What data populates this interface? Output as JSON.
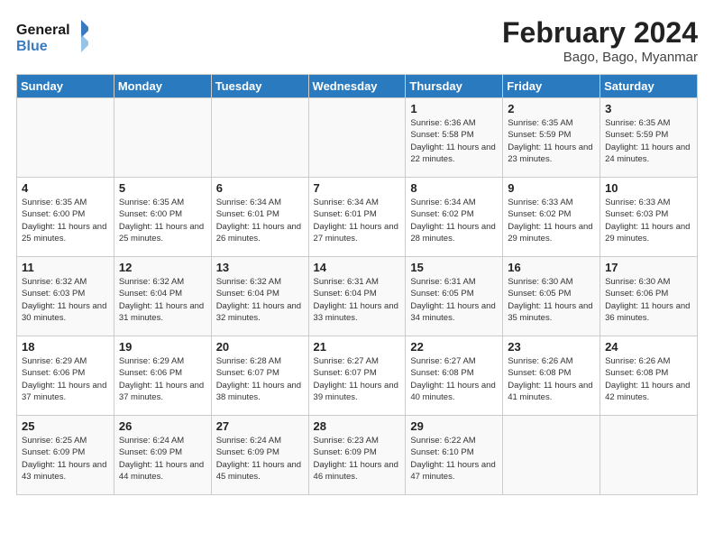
{
  "header": {
    "logo_line1": "General",
    "logo_line2": "Blue",
    "title": "February 2024",
    "subtitle": "Bago, Bago, Myanmar"
  },
  "days_of_week": [
    "Sunday",
    "Monday",
    "Tuesday",
    "Wednesday",
    "Thursday",
    "Friday",
    "Saturday"
  ],
  "weeks": [
    [
      {
        "day": "",
        "info": ""
      },
      {
        "day": "",
        "info": ""
      },
      {
        "day": "",
        "info": ""
      },
      {
        "day": "",
        "info": ""
      },
      {
        "day": "1",
        "info": "Sunrise: 6:36 AM\nSunset: 5:58 PM\nDaylight: 11 hours and 22 minutes."
      },
      {
        "day": "2",
        "info": "Sunrise: 6:35 AM\nSunset: 5:59 PM\nDaylight: 11 hours and 23 minutes."
      },
      {
        "day": "3",
        "info": "Sunrise: 6:35 AM\nSunset: 5:59 PM\nDaylight: 11 hours and 24 minutes."
      }
    ],
    [
      {
        "day": "4",
        "info": "Sunrise: 6:35 AM\nSunset: 6:00 PM\nDaylight: 11 hours and 25 minutes."
      },
      {
        "day": "5",
        "info": "Sunrise: 6:35 AM\nSunset: 6:00 PM\nDaylight: 11 hours and 25 minutes."
      },
      {
        "day": "6",
        "info": "Sunrise: 6:34 AM\nSunset: 6:01 PM\nDaylight: 11 hours and 26 minutes."
      },
      {
        "day": "7",
        "info": "Sunrise: 6:34 AM\nSunset: 6:01 PM\nDaylight: 11 hours and 27 minutes."
      },
      {
        "day": "8",
        "info": "Sunrise: 6:34 AM\nSunset: 6:02 PM\nDaylight: 11 hours and 28 minutes."
      },
      {
        "day": "9",
        "info": "Sunrise: 6:33 AM\nSunset: 6:02 PM\nDaylight: 11 hours and 29 minutes."
      },
      {
        "day": "10",
        "info": "Sunrise: 6:33 AM\nSunset: 6:03 PM\nDaylight: 11 hours and 29 minutes."
      }
    ],
    [
      {
        "day": "11",
        "info": "Sunrise: 6:32 AM\nSunset: 6:03 PM\nDaylight: 11 hours and 30 minutes."
      },
      {
        "day": "12",
        "info": "Sunrise: 6:32 AM\nSunset: 6:04 PM\nDaylight: 11 hours and 31 minutes."
      },
      {
        "day": "13",
        "info": "Sunrise: 6:32 AM\nSunset: 6:04 PM\nDaylight: 11 hours and 32 minutes."
      },
      {
        "day": "14",
        "info": "Sunrise: 6:31 AM\nSunset: 6:04 PM\nDaylight: 11 hours and 33 minutes."
      },
      {
        "day": "15",
        "info": "Sunrise: 6:31 AM\nSunset: 6:05 PM\nDaylight: 11 hours and 34 minutes."
      },
      {
        "day": "16",
        "info": "Sunrise: 6:30 AM\nSunset: 6:05 PM\nDaylight: 11 hours and 35 minutes."
      },
      {
        "day": "17",
        "info": "Sunrise: 6:30 AM\nSunset: 6:06 PM\nDaylight: 11 hours and 36 minutes."
      }
    ],
    [
      {
        "day": "18",
        "info": "Sunrise: 6:29 AM\nSunset: 6:06 PM\nDaylight: 11 hours and 37 minutes."
      },
      {
        "day": "19",
        "info": "Sunrise: 6:29 AM\nSunset: 6:06 PM\nDaylight: 11 hours and 37 minutes."
      },
      {
        "day": "20",
        "info": "Sunrise: 6:28 AM\nSunset: 6:07 PM\nDaylight: 11 hours and 38 minutes."
      },
      {
        "day": "21",
        "info": "Sunrise: 6:27 AM\nSunset: 6:07 PM\nDaylight: 11 hours and 39 minutes."
      },
      {
        "day": "22",
        "info": "Sunrise: 6:27 AM\nSunset: 6:08 PM\nDaylight: 11 hours and 40 minutes."
      },
      {
        "day": "23",
        "info": "Sunrise: 6:26 AM\nSunset: 6:08 PM\nDaylight: 11 hours and 41 minutes."
      },
      {
        "day": "24",
        "info": "Sunrise: 6:26 AM\nSunset: 6:08 PM\nDaylight: 11 hours and 42 minutes."
      }
    ],
    [
      {
        "day": "25",
        "info": "Sunrise: 6:25 AM\nSunset: 6:09 PM\nDaylight: 11 hours and 43 minutes."
      },
      {
        "day": "26",
        "info": "Sunrise: 6:24 AM\nSunset: 6:09 PM\nDaylight: 11 hours and 44 minutes."
      },
      {
        "day": "27",
        "info": "Sunrise: 6:24 AM\nSunset: 6:09 PM\nDaylight: 11 hours and 45 minutes."
      },
      {
        "day": "28",
        "info": "Sunrise: 6:23 AM\nSunset: 6:09 PM\nDaylight: 11 hours and 46 minutes."
      },
      {
        "day": "29",
        "info": "Sunrise: 6:22 AM\nSunset: 6:10 PM\nDaylight: 11 hours and 47 minutes."
      },
      {
        "day": "",
        "info": ""
      },
      {
        "day": "",
        "info": ""
      }
    ]
  ]
}
